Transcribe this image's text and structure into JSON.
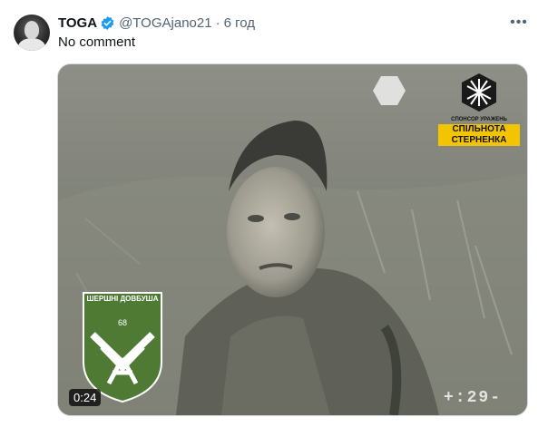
{
  "tweet": {
    "author_name": "TOGA",
    "handle": "@TOGAjano21",
    "separator": "·",
    "time": "6 год",
    "more_label": "•••",
    "text": "No comment"
  },
  "media": {
    "duration": "0:24",
    "sponsor_caption": "СПОНСОР УРАЖЕНЬ",
    "sponsor_line1": "СПІЛЬНОТА",
    "sponsor_line2": "СТЕРНЕНКА",
    "badge_label": "ШЕРШНІ ДОВБУША",
    "badge_number": "68",
    "osd_text": "+:29-"
  },
  "colors": {
    "verified": "#1d9bf0",
    "badge_green": "#4e7a34",
    "sponsor_yellow": "#f2c500"
  },
  "icons": {
    "verified": "verified-badge-icon",
    "more": "more-dots-icon"
  }
}
